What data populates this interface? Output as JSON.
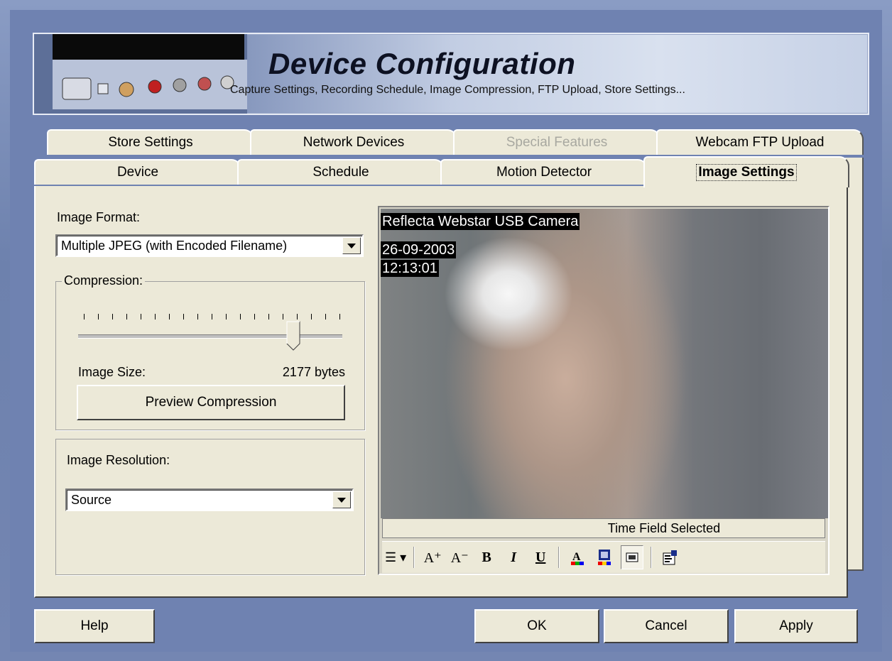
{
  "banner": {
    "title": "Device Configuration",
    "subtitle": "Capture Settings, Recording Schedule,  Image Compression, FTP Upload, Store Settings..."
  },
  "tabs_back": [
    {
      "label": "Store Settings",
      "disabled": false
    },
    {
      "label": "Network Devices",
      "disabled": false
    },
    {
      "label": "Special Features",
      "disabled": true
    },
    {
      "label": "Webcam FTP Upload",
      "disabled": false
    }
  ],
  "tabs_front": [
    {
      "label": "Device"
    },
    {
      "label": "Schedule"
    },
    {
      "label": "Motion Detector"
    },
    {
      "label": "Image Settings",
      "active": true
    }
  ],
  "image_format": {
    "label": "Image Format:",
    "value": "Multiple JPEG (with Encoded Filename)"
  },
  "compression": {
    "legend": "Compression:",
    "slider_level_percent": 86,
    "image_size_label": "Image Size:",
    "image_size_value": "2177 bytes",
    "preview_button": "Preview Compression"
  },
  "resolution": {
    "label": "Image Resolution:",
    "value": "Source"
  },
  "camera": {
    "name": "Reflecta Webstar USB Camera",
    "date": "26-09-2003",
    "time": "12:13:01",
    "status": "Time Field Selected"
  },
  "format_toolbar": {
    "list": "☰ ▾",
    "font_larger": "A⁺",
    "font_smaller": "A⁻",
    "bold": "B",
    "italic": "I",
    "underline": "U"
  },
  "buttons": {
    "help": "Help",
    "ok": "OK",
    "cancel": "Cancel",
    "apply": "Apply"
  }
}
